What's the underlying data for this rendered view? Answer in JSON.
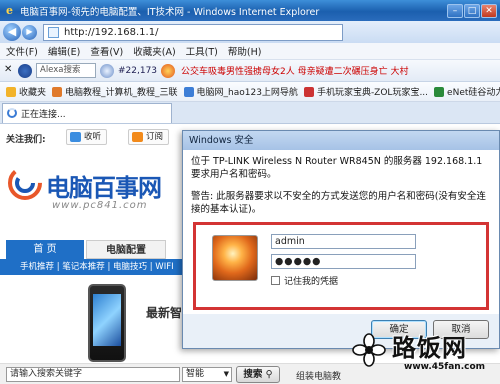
{
  "window": {
    "title": "电脑百事网-领先的电脑配置、IT技术网 - Windows Internet Explorer",
    "controls": [
      "minimize",
      "maximize",
      "close"
    ]
  },
  "address_bar": {
    "url": "http://192.168.1.1/",
    "back_icon": "back-arrow-icon",
    "forward_icon": "forward-arrow-icon"
  },
  "menu": [
    "文件(F)",
    "编辑(E)",
    "查看(V)",
    "收藏夹(A)",
    "工具(T)",
    "帮助(H)"
  ],
  "toolbar": {
    "alexa_placeholder": "Alexa搜索",
    "count": "#22,173",
    "ticker": "公交车吸毒男性强掳母女2人 母亲疑遭二次碾压身亡 大村"
  },
  "favorites": [
    {
      "label": "收藏夹",
      "color": "#f2b32a"
    },
    {
      "label": "电脑教程_计算机_教程_三联",
      "color": "#e07a2b"
    },
    {
      "label": "电脑网_hao123上网导航",
      "color": "#3d7ed6"
    },
    {
      "label": "手机玩家宝典-ZOL玩家宝...",
      "color": "#c33"
    },
    {
      "label": "eNet硅谷动力",
      "color": "#2a8a3a"
    }
  ],
  "tab": {
    "label": "正在连接..."
  },
  "site": {
    "follow_label": "关注我们:",
    "share_buttons": [
      {
        "label": "收听",
        "color": "#3b8de0"
      },
      {
        "label": "订阅",
        "color": "#f28a1b"
      }
    ],
    "logo_text": "电脑百事网",
    "logo_url": "www.pc841.com",
    "nav_tabs": [
      {
        "label": "首 页",
        "active": true
      },
      {
        "label": "电脑配置",
        "active": false
      }
    ],
    "subnav": "手机推荐 | 笔记本推荐 | 电脑技巧 | WIFI",
    "newest": "最新智",
    "search_placeholder": "请输入搜索关键字",
    "search_select": "智能",
    "search_button": "搜索",
    "assembly_text": "组装电脑教"
  },
  "dialog": {
    "title": "Windows 安全",
    "message": "位于 TP-LINK Wireless N Router WR845N 的服务器 192.168.1.1 要求用户名和密码。",
    "warning": "警告: 此服务器要求以不安全的方式发送您的用户名和密码(没有安全连接的基本认证)。",
    "username": "admin",
    "password_mask": "●●●●●",
    "remember_label": "记住我的凭据",
    "ok_label": "确定",
    "cancel_label": "取消"
  },
  "watermark": {
    "text": "路饭网",
    "url": "www.45fan.com"
  }
}
